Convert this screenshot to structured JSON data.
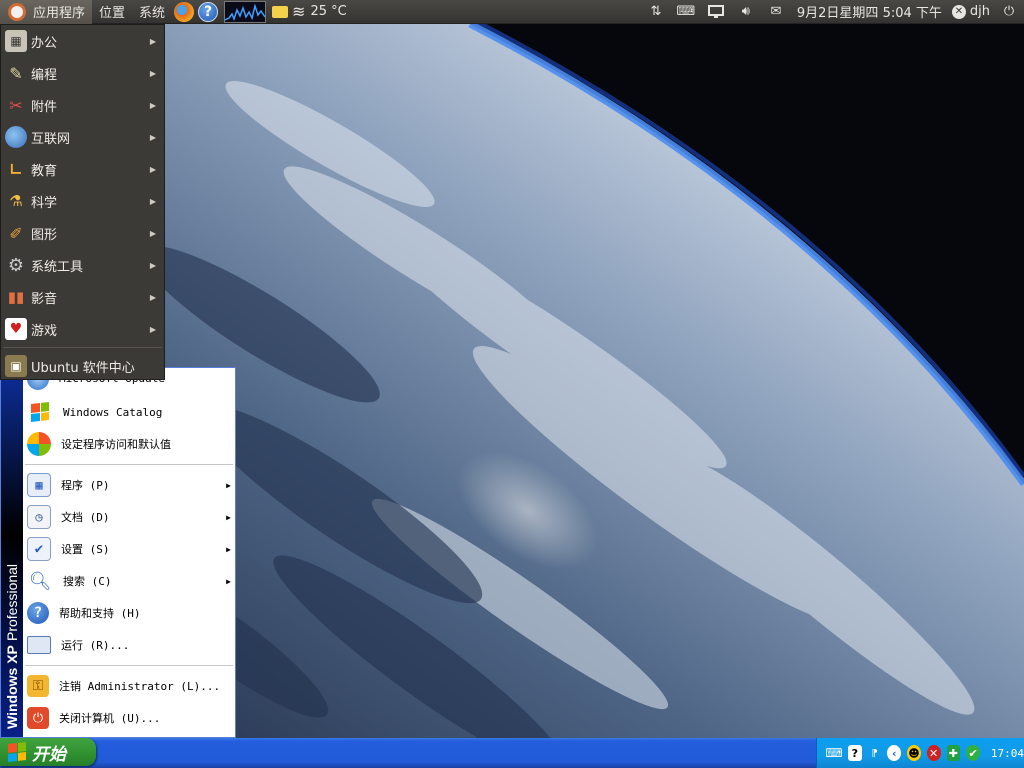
{
  "top_panel": {
    "menus": [
      "应用程序",
      "位置",
      "系统"
    ],
    "weather": "25 °C",
    "clock": "9月2日星期四  5:04 下午",
    "user": "djh",
    "icons": [
      "ubuntu-logo-icon",
      "firefox-icon",
      "help-icon",
      "system-monitor-icon",
      "folder-icon",
      "weather-fog-icon",
      "network-icon",
      "keyboard-icon",
      "display-icon",
      "volume-icon",
      "mail-icon",
      "user-icon",
      "power-icon"
    ]
  },
  "gnome_menu": {
    "items": [
      {
        "label": "办公",
        "icon": "office-icon"
      },
      {
        "label": "编程",
        "icon": "programming-icon"
      },
      {
        "label": "附件",
        "icon": "accessories-icon"
      },
      {
        "label": "互联网",
        "icon": "internet-icon"
      },
      {
        "label": "教育",
        "icon": "education-icon"
      },
      {
        "label": "科学",
        "icon": "science-icon"
      },
      {
        "label": "图形",
        "icon": "graphics-icon"
      },
      {
        "label": "系统工具",
        "icon": "system-tools-icon"
      },
      {
        "label": "影音",
        "icon": "multimedia-icon"
      },
      {
        "label": "游戏",
        "icon": "games-icon"
      }
    ],
    "software_center": "Ubuntu 软件中心"
  },
  "xp_start_menu": {
    "side_brand": "Windows XP",
    "side_edition": "Professional",
    "top_items": [
      {
        "label": "Microsoft Update",
        "icon": "microsoft-update-icon"
      },
      {
        "label": "Windows Catalog",
        "icon": "windows-catalog-icon"
      },
      {
        "label": "设定程序访问和默认值",
        "icon": "program-access-icon"
      }
    ],
    "main_items": [
      {
        "label": "程序 (P)",
        "icon": "programs-icon",
        "submenu": true
      },
      {
        "label": "文档 (D)",
        "icon": "documents-icon",
        "submenu": true
      },
      {
        "label": "设置 (S)",
        "icon": "settings-icon",
        "submenu": true
      },
      {
        "label": "搜索 (C)",
        "icon": "search-icon",
        "submenu": true
      },
      {
        "label": "帮助和支持 (H)",
        "icon": "help-support-icon",
        "submenu": false
      },
      {
        "label": "运行 (R)...",
        "icon": "run-icon",
        "submenu": false
      }
    ],
    "bottom_items": [
      {
        "label": "注销 Administrator (L)...",
        "icon": "logoff-icon"
      },
      {
        "label": "关闭计算机 (U)...",
        "icon": "shutdown-icon"
      }
    ]
  },
  "xp_taskbar": {
    "start_label": "开始",
    "time": "17:04"
  },
  "colors": {
    "gnome_panel": "#3b3935",
    "xp_blue": "#245edc",
    "xp_green": "#2f8f2f"
  }
}
